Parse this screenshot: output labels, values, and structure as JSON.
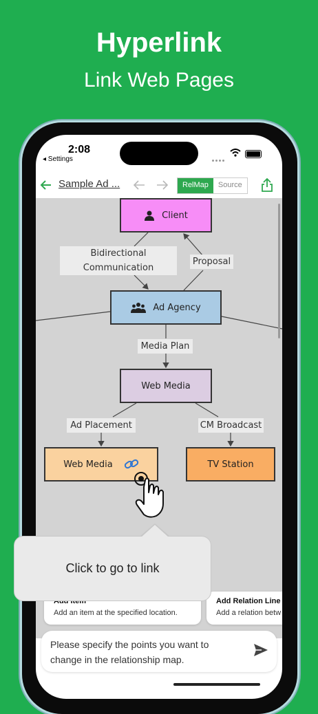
{
  "hero": {
    "title": "Hyperlink",
    "subtitle": "Link Web Pages"
  },
  "status_bar": {
    "time": "2:08",
    "back_app": "◂ Settings"
  },
  "toolbar": {
    "title": "Sample Ad ...",
    "seg_relmap": "RelMap",
    "seg_source": "Source",
    "accent_color": "#2ea84f"
  },
  "diagram": {
    "nodes": {
      "client": "Client",
      "agency": "Ad Agency",
      "web_media": "Web Media",
      "web_media_link": "Web Media",
      "tv_station": "TV Station"
    },
    "edges": {
      "bidirectional_line1": "Bidirectional",
      "bidirectional_line2": "Communication",
      "proposal": "Proposal",
      "media_plan": "Media Plan",
      "ad_placement": "Ad Placement",
      "cm_broadcast": "CM Broadcast"
    },
    "colors": {
      "client": "#f78df7",
      "agency": "#aacbe4",
      "web_media": "#dccde2",
      "web_media_link": "#fad29f",
      "tv_station": "#f9ad63",
      "background": "#d3d3d3"
    }
  },
  "popup": {
    "text": "Click to go to link"
  },
  "suggestions": [
    {
      "title": "Add Item",
      "desc": "Add an item at the specified location."
    },
    {
      "title": "Add Relation Line",
      "desc": "Add a relation betw"
    }
  ],
  "input": {
    "text": "Please specify the points you want to change in the relationship map."
  },
  "icons": [
    "back-arrow-icon",
    "undo-icon",
    "redo-icon",
    "share-icon",
    "person-icon",
    "group-icon",
    "link-icon",
    "tap-hand-icon",
    "send-icon",
    "wifi-icon",
    "battery-icon"
  ]
}
